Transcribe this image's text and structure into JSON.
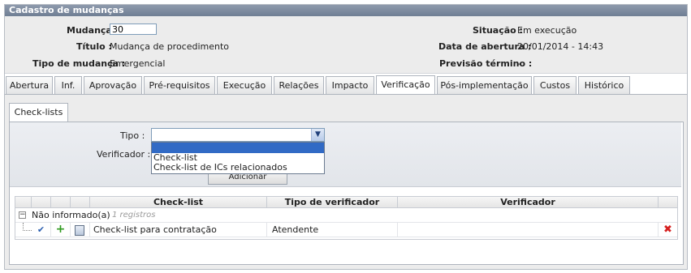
{
  "window": {
    "title": "Cadastro de mudanças"
  },
  "header": {
    "mudanca_label": "Mudança :",
    "mudanca_value": "30",
    "titulo_label": "Título :",
    "titulo_value": "Mudança de procedimento",
    "tipo_label": "Tipo de mudança :",
    "tipo_value": "Emergencial",
    "situacao_label": "Situação :",
    "situacao_value": "Em execução",
    "abertura_label": "Data de abertura :",
    "abertura_value": "20/01/2014 - 14:43",
    "previsao_label": "Previsão término :",
    "previsao_value": "-"
  },
  "tabs": [
    "Abertura",
    "Inf.",
    "Aprovação",
    "Pré-requisitos",
    "Execução",
    "Relações",
    "Impacto",
    "Verificação",
    "Pós-implementação",
    "Custos",
    "Histórico"
  ],
  "active_tab": "Verificação",
  "subtab": {
    "label": "Check-lists"
  },
  "form": {
    "tipo_label": "Tipo :",
    "tipo_selected": "",
    "tipo_options": [
      "",
      "Check-list",
      "Check-list de ICs relacionados"
    ],
    "verificador_label": "Verificador :",
    "add_button": "Adicionar"
  },
  "grid": {
    "columns": [
      "Check-list",
      "Tipo de verificador",
      "Verificador"
    ],
    "group_label": "Não informado(a)",
    "group_count": "1 registros",
    "rows": [
      {
        "checklist": "Check-list para contratação",
        "tipo": "Atendente",
        "verificador": ""
      }
    ]
  },
  "icons": {
    "edit": "edit-check-icon",
    "add": "plus-icon",
    "report": "report-icon",
    "delete": "delete-x-icon",
    "dropdown": "chevron-down-icon"
  },
  "colors": {
    "title_bar": "#7a889c",
    "selection": "#316ac5",
    "add_green": "#2f9a1f",
    "delete_red": "#d62020"
  }
}
